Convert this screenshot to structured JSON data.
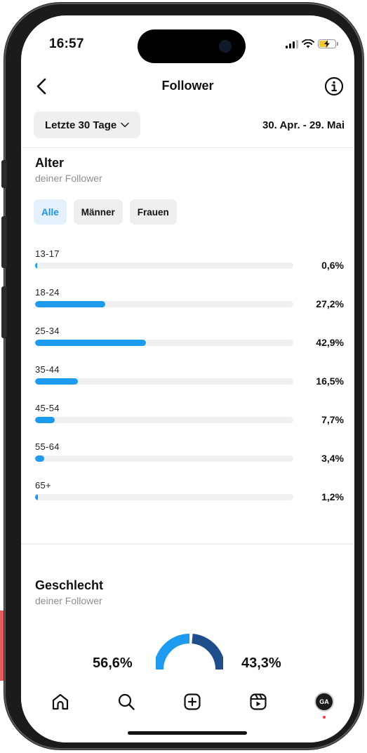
{
  "status_bar": {
    "time": "16:57"
  },
  "header": {
    "title": "Follower",
    "back_icon": "chevron-left-icon",
    "info_icon": "info-icon"
  },
  "filter": {
    "range_label": "Letzte 30 Tage",
    "date_range": "30. Apr. - 29. Mai"
  },
  "age": {
    "title": "Alter",
    "subtitle": "deiner Follower",
    "segments": [
      {
        "label": "Alle",
        "active": true
      },
      {
        "label": "Männer",
        "active": false
      },
      {
        "label": "Frauen",
        "active": false
      }
    ],
    "groups": [
      {
        "label": "13-17",
        "value": 0.6,
        "display": "0,6%"
      },
      {
        "label": "18-24",
        "value": 27.2,
        "display": "27,2%"
      },
      {
        "label": "25-34",
        "value": 42.9,
        "display": "42,9%"
      },
      {
        "label": "35-44",
        "value": 16.5,
        "display": "16,5%"
      },
      {
        "label": "45-54",
        "value": 7.7,
        "display": "7,7%"
      },
      {
        "label": "55-64",
        "value": 3.4,
        "display": "3,4%"
      },
      {
        "label": "65+",
        "value": 1.2,
        "display": "1,2%"
      }
    ]
  },
  "gender": {
    "title": "Geschlecht",
    "subtitle": "deiner Follower",
    "left_pct": "56,6%",
    "right_pct": "43,3%",
    "left_value": 56.6,
    "right_value": 43.3
  },
  "tabbar": {
    "icons": [
      "home-icon",
      "search-icon",
      "create-icon",
      "reels-icon",
      "profile-avatar"
    ],
    "avatar_text": "GA"
  },
  "colors": {
    "accent": "#1d9bf0",
    "accent_dark": "#1e4e8c",
    "track": "#f0f0f0"
  }
}
